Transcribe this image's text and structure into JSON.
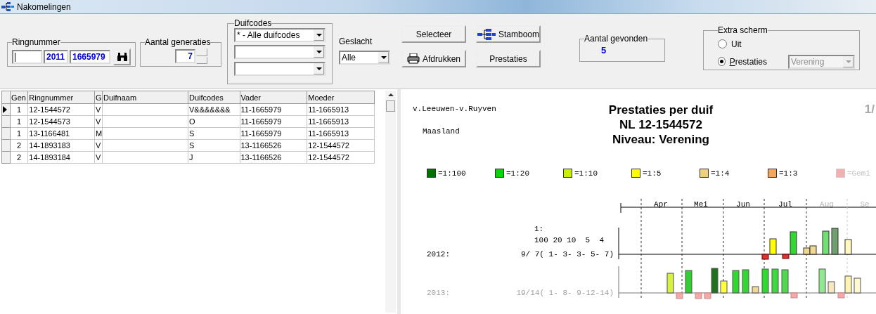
{
  "window": {
    "title": "Nakomelingen"
  },
  "ringnummer": {
    "label": "Ringnummer",
    "year": "2011",
    "number": "1665979"
  },
  "generations": {
    "label": "Aantal generaties",
    "value": "7"
  },
  "duifcodes": {
    "label": "Duifcodes",
    "combos": [
      "* - Alle duifcodes"
    ]
  },
  "geslacht": {
    "label": "Geslacht",
    "value": "Alle"
  },
  "buttons": [
    {
      "label": "Selecteer",
      "kind": "plain"
    },
    {
      "label": "Stamboom",
      "kind": "tree"
    },
    {
      "label": "Afdrukken",
      "kind": "printer"
    },
    {
      "label": "Prestaties",
      "kind": "plain"
    }
  ],
  "found": {
    "label": "Aantal gevonden",
    "value": "5"
  },
  "extra_screen": {
    "label": "Extra scherm",
    "options": [
      {
        "label": "Uit",
        "selected": false
      },
      {
        "label": "Prestaties",
        "selected": true
      }
    ],
    "level_select": {
      "value": "Verening",
      "disabled": true
    }
  },
  "table": {
    "columns": [
      "Gen",
      "Ringnummer",
      "G",
      "Duifnaam",
      "Duifcodes",
      "Vader",
      "Moeder"
    ],
    "rows": [
      {
        "selected": true,
        "cells": [
          "1",
          "12-1544572",
          "V",
          "",
          "V&&&&&&&",
          "11-1665979",
          "11-1665913"
        ]
      },
      {
        "selected": false,
        "cells": [
          "1",
          "12-1544573",
          "V",
          "",
          "O",
          "11-1665979",
          "11-1665913"
        ]
      },
      {
        "selected": false,
        "cells": [
          "1",
          "13-1166481",
          "M",
          "",
          "S",
          "11-1665979",
          "11-1665913"
        ]
      },
      {
        "selected": false,
        "cells": [
          "2",
          "14-1893183",
          "V",
          "",
          "S",
          "13-1166526",
          "12-1544572"
        ]
      },
      {
        "selected": false,
        "cells": [
          "2",
          "14-1893184",
          "V",
          "",
          "J",
          "13-1166526",
          "12-1544572"
        ]
      }
    ]
  },
  "report": {
    "club": "v.Leeuwen-v.Ruyven",
    "place": "Maasland",
    "title_lines": [
      "Prestaties per duif",
      "NL 12-1544572",
      "Niveau: Verening"
    ],
    "page": "1/",
    "legend": [
      {
        "label": "=1:100",
        "color": "#007000",
        "faded": false
      },
      {
        "label": "=1:20",
        "color": "#00d800",
        "faded": false
      },
      {
        "label": "=1:10",
        "color": "#c8f000",
        "faded": false
      },
      {
        "label": "=1:5",
        "color": "#ffff00",
        "faded": false
      },
      {
        "label": "=1:4",
        "color": "#f0d080",
        "faded": false
      },
      {
        "label": "=1:3",
        "color": "#f0a860",
        "faded": false
      },
      {
        "label": "=Gemi",
        "color": "#f4b0b0",
        "faded": true
      }
    ],
    "months": [
      {
        "label": "Apr",
        "faded": false
      },
      {
        "label": "Mei",
        "faded": false
      },
      {
        "label": "Jun",
        "faded": false
      },
      {
        "label": "Jul",
        "faded": false
      },
      {
        "label": "Aug",
        "faded": true
      },
      {
        "label": "Se",
        "faded": true
      }
    ],
    "ratio_header": [
      "1:",
      "100 20 10  5  4"
    ],
    "years": [
      {
        "year": "2012:",
        "summary": "9/ 7( 1- 3- 3- 5- 7)",
        "faded": false
      },
      {
        "year": "2013:",
        "summary": "19/14( 1- 8- 9-12-14)",
        "faded": true
      }
    ]
  }
}
